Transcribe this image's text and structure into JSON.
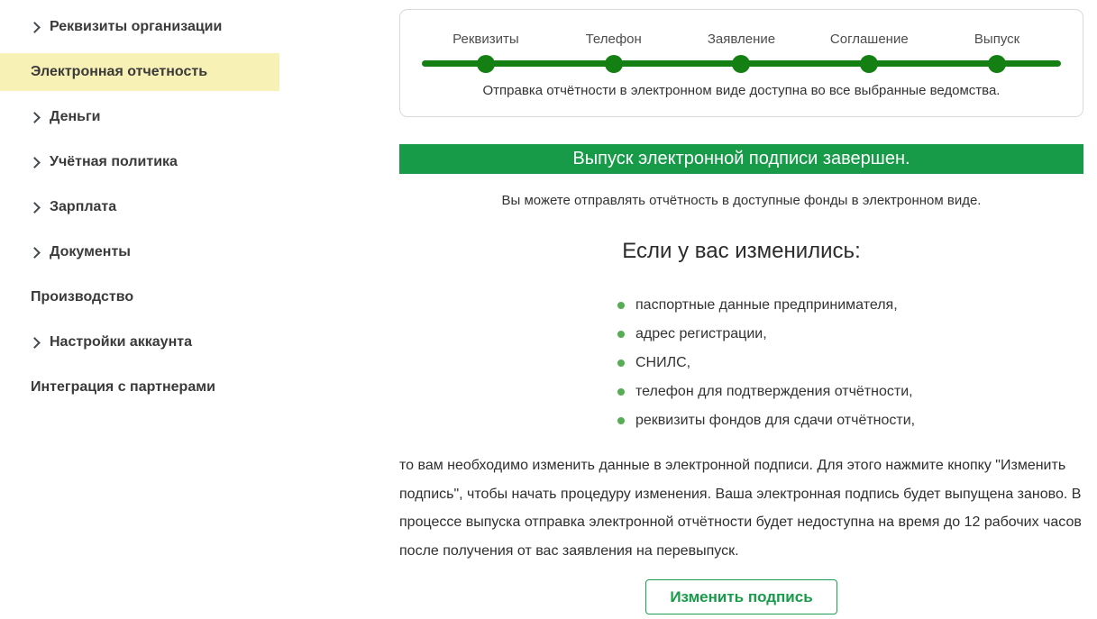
{
  "sidebar": {
    "items": [
      {
        "label": "Реквизиты организации",
        "chevron": true,
        "active": false
      },
      {
        "label": "Электронная отчетность",
        "chevron": false,
        "active": true
      },
      {
        "label": "Деньги",
        "chevron": true,
        "active": false
      },
      {
        "label": "Учётная политика",
        "chevron": true,
        "active": false
      },
      {
        "label": "Зарплата",
        "chevron": true,
        "active": false
      },
      {
        "label": "Документы",
        "chevron": true,
        "active": false
      },
      {
        "label": "Производство",
        "chevron": false,
        "active": false
      },
      {
        "label": "Настройки аккаунта",
        "chevron": true,
        "active": false
      },
      {
        "label": "Интеграция с партнерами",
        "chevron": false,
        "active": false
      }
    ]
  },
  "stepper": {
    "steps": [
      "Реквизиты",
      "Телефон",
      "Заявление",
      "Соглашение",
      "Выпуск"
    ],
    "caption": "Отправка отчётности в электронном виде доступна во все выбранные ведомства."
  },
  "banner": {
    "text": "Выпуск электронной подписи завершен."
  },
  "main": {
    "subtitle": "Вы можете отправлять отчётность в доступные фонды в электронном виде.",
    "heading": "Если у вас изменились:",
    "bullets": [
      "паспортные данные предпринимателя,",
      "адрес регистрации,",
      "СНИЛС,",
      "телефон для подтверждения отчётности,",
      "реквизиты фондов для сдачи отчётности,"
    ],
    "paragraph": "то вам необходимо изменить данные в электронной подписи. Для этого нажмите кнопку \"Изменить подпись\", чтобы начать процедуру изменения. Ваша электронная подпись будет выпущена заново. В процессе выпуска отправка электронной отчётности будет недоступна на время до 12 рабочих часов после получения от вас заявления на перевыпуск.",
    "button_label": "Изменить подпись"
  },
  "colors": {
    "stepper_green": "#148014",
    "banner_green": "#179b49",
    "button_green": "#179b49",
    "bullet_green": "#55ae55",
    "active_item_yellow": "#f8f1b6"
  }
}
